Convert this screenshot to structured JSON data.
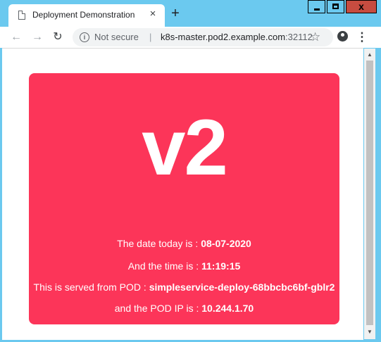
{
  "browser": {
    "tab_title": "Deployment Demonstration",
    "tab_close": "×",
    "new_tab": "+",
    "security_label": "Not secure",
    "separator": "|",
    "url_host": "k8s-master.pod2.example.com",
    "url_port": ":32112",
    "window_buttons": {
      "minimize": "",
      "maximize": "",
      "close": "x"
    }
  },
  "page": {
    "version": "v2",
    "date_label": "The date today is : ",
    "date_value": "08-07-2020",
    "time_label": "And the time is : ",
    "time_value": "11:19:15",
    "pod_label": "This is served from POD : ",
    "pod_value": "simpleservice-deploy-68bbcbc6bf-gblr2",
    "ip_label": "and the POD IP is : ",
    "ip_value": "10.244.1.70"
  },
  "colors": {
    "card": "#fc3559",
    "chrome_frame": "#6bc9ef"
  },
  "icons": [
    "page-icon",
    "close-icon",
    "plus-icon",
    "back-icon",
    "forward-icon",
    "reload-icon",
    "info-icon",
    "star-icon",
    "account-icon",
    "menu-icon"
  ]
}
